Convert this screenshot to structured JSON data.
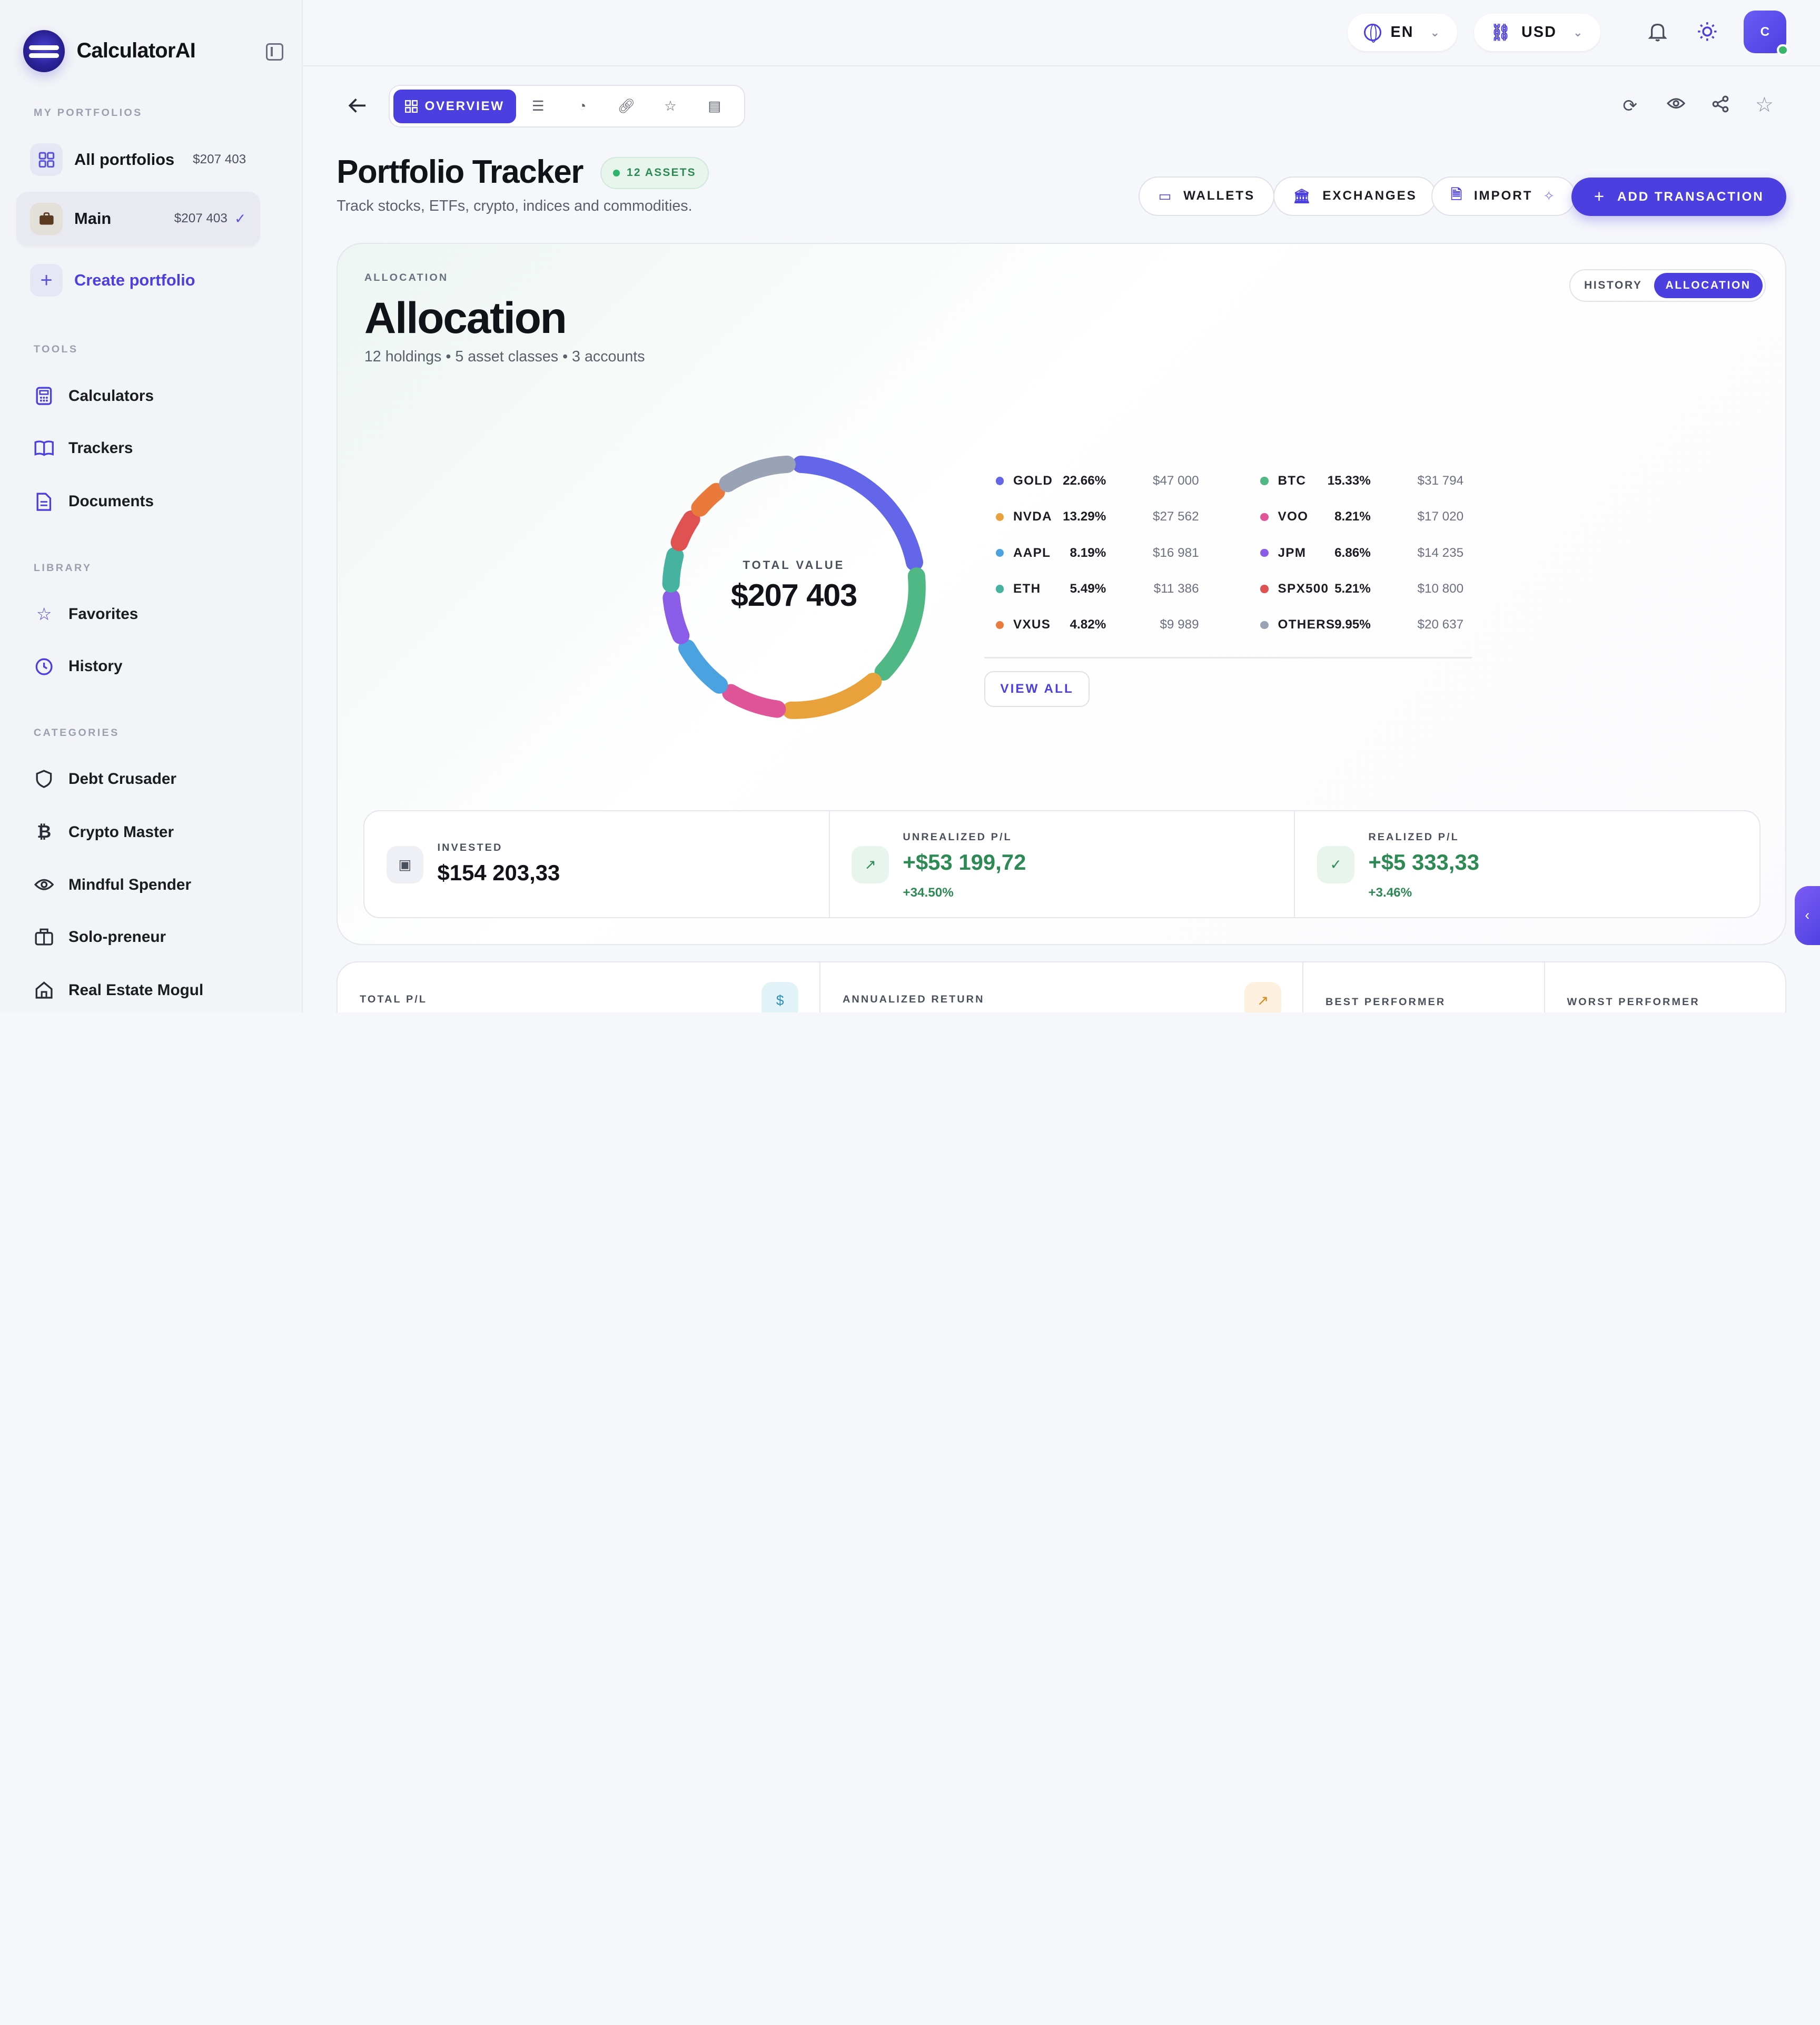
{
  "brand": {
    "name": "CalculatorAI"
  },
  "sidebar": {
    "portfolios_label": "MY PORTFOLIOS",
    "portfolios": [
      {
        "name": "All portfolios",
        "value": "$207 403"
      },
      {
        "name": "Main",
        "value": "$207 403"
      }
    ],
    "create_label": "Create portfolio",
    "tools_label": "TOOLS",
    "tools": [
      "Calculators",
      "Trackers",
      "Documents"
    ],
    "library_label": "LIBRARY",
    "library": [
      "Favorites",
      "History"
    ],
    "categories_label": "CATEGORIES",
    "categories": [
      "Debt Crusader",
      "Crypto Master",
      "Mindful Spender",
      "Solo-preneur",
      "Real Estate Mogul"
    ]
  },
  "topbar": {
    "language": "EN",
    "currency": "USD",
    "avatar_initial": "C"
  },
  "tabs": {
    "active_label": "OVERVIEW"
  },
  "page": {
    "title": "Portfolio Tracker",
    "badge": "12 ASSETS",
    "subtitle": "Track stocks, ETFs, crypto, indices and commodities."
  },
  "actions": {
    "wallets": "WALLETS",
    "exchanges": "EXCHANGES",
    "import": "IMPORT",
    "add": "ADD TRANSACTION"
  },
  "allocation": {
    "eyebrow": "ALLOCATION",
    "title": "Allocation",
    "summary": "12 holdings • 5 asset classes • 3 accounts",
    "toggle": [
      "HISTORY",
      "ALLOCATION"
    ],
    "total_label": "TOTAL VALUE",
    "total_value": "$207 403",
    "view_all": "VIEW ALL",
    "holdings": [
      {
        "symbol": "GOLD",
        "pct": "22.66%",
        "value": "$47 000",
        "share": 22.66,
        "color": "#6366e8"
      },
      {
        "symbol": "BTC",
        "pct": "15.33%",
        "value": "$31 794",
        "share": 15.33,
        "color": "#4fb884"
      },
      {
        "symbol": "NVDA",
        "pct": "13.29%",
        "value": "$27 562",
        "share": 13.29,
        "color": "#e9a23b"
      },
      {
        "symbol": "VOO",
        "pct": "8.21%",
        "value": "$17 020",
        "share": 8.21,
        "color": "#e0559a"
      },
      {
        "symbol": "AAPL",
        "pct": "8.19%",
        "value": "$16 981",
        "share": 8.19,
        "color": "#4aa3e0"
      },
      {
        "symbol": "JPM",
        "pct": "6.86%",
        "value": "$14 235",
        "share": 6.86,
        "color": "#8b5ce8"
      },
      {
        "symbol": "ETH",
        "pct": "5.49%",
        "value": "$11 386",
        "share": 5.49,
        "color": "#45b3a0"
      },
      {
        "symbol": "SPX500",
        "pct": "5.21%",
        "value": "$10 800",
        "share": 5.21,
        "color": "#e05252"
      },
      {
        "symbol": "VXUS",
        "pct": "4.82%",
        "value": "$9 989",
        "share": 4.82,
        "color": "#ea7a3b"
      },
      {
        "symbol": "OTHERS",
        "pct": "9.95%",
        "value": "$20 637",
        "share": 9.95,
        "color": "#9aa3b5"
      }
    ]
  },
  "stats": {
    "invested_label": "INVESTED",
    "invested_value": "$154 203,33",
    "unrealized_label": "UNREALIZED P/L",
    "unrealized_value": "+$53 199,72",
    "unrealized_pct": "+34.50%",
    "realized_label": "REALIZED P/L",
    "realized_value": "+$5 333,33",
    "realized_pct": "+3.46%"
  },
  "bottom": {
    "total_pl": "TOTAL P/L",
    "annualized": "ANNUALIZED RETURN",
    "best": "BEST PERFORMER",
    "worst": "WORST PERFORMER"
  },
  "icons": {
    "brand": "logo-icon",
    "collapse": "sidebar-collapse-icon",
    "globe": "globe-icon",
    "currency": "currency-icon",
    "bell": "bell-icon",
    "sun": "sun-icon",
    "back": "arrow-left-icon",
    "refresh": "refresh-icon",
    "eye": "eye-icon",
    "share": "share-icon",
    "star": "star-icon"
  },
  "colors": {
    "accent": "#4b3fe0",
    "positive": "#2d8a54"
  }
}
